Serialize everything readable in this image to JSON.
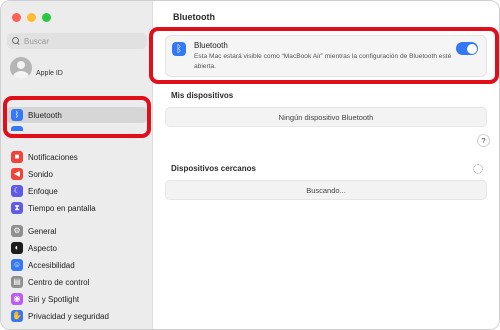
{
  "window": {
    "traffic_lights": {
      "close": "#fe5f57",
      "minimize": "#febc2e",
      "maximize": "#28c840"
    }
  },
  "sidebar": {
    "search_placeholder": "Buscar",
    "account_label": "Apple ID",
    "items": [
      {
        "label": "Bluetooth",
        "icon": "bluetooth-icon",
        "color": "#3478f6",
        "selected": true
      },
      {
        "label": "Notificaciones",
        "icon": "bell-icon",
        "color": "#f0433a"
      },
      {
        "label": "Sonido",
        "icon": "speaker-icon",
        "color": "#f0433a"
      },
      {
        "label": "Enfoque",
        "icon": "moon-icon",
        "color": "#5e5ce6"
      },
      {
        "label": "Tiempo en pantalla",
        "icon": "hourglass-icon",
        "color": "#5e5ce6"
      },
      {
        "label": "General",
        "icon": "gear-icon",
        "color": "#8e8e93"
      },
      {
        "label": "Aspecto",
        "icon": "appearance-icon",
        "color": "#1d1d1f"
      },
      {
        "label": "Accesibilidad",
        "icon": "accessibility-icon",
        "color": "#3478f6"
      },
      {
        "label": "Centro de control",
        "icon": "control-center-icon",
        "color": "#8e8e93"
      },
      {
        "label": "Siri y Spotlight",
        "icon": "siri-icon",
        "color": "#bf5af2"
      },
      {
        "label": "Privacidad y seguridad",
        "icon": "hand-icon",
        "color": "#3478f6"
      }
    ]
  },
  "main": {
    "title": "Bluetooth",
    "bluetooth": {
      "title": "Bluetooth",
      "description": "Esta Mac estará visible como “MacBook Air” mientras la configuración de Bluetooth esté abierta.",
      "enabled": true
    },
    "my_devices": {
      "title": "Mis dispositivos",
      "empty": "Ningún dispositivo Bluetooth"
    },
    "help": "?",
    "nearby": {
      "title": "Dispositivos cercanos",
      "status": "Buscando..."
    }
  }
}
